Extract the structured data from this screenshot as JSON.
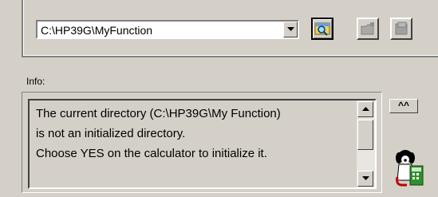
{
  "directory": {
    "path": "C:\\HP39G\\MyFunction"
  },
  "toolbar": {
    "icons": [
      "browse-folder-icon",
      "new-folder-icon",
      "save-icon"
    ]
  },
  "info": {
    "label": "Info:",
    "lines": [
      "The current directory (C:\\HP39G\\My Function)",
      "is not an initialized directory.",
      "Choose YES on the calculator to initialize it."
    ],
    "collapse_label": "^^"
  },
  "colors": {
    "face": "#d4d0c8",
    "shadow": "#808080",
    "highlight": "#ffffff"
  }
}
